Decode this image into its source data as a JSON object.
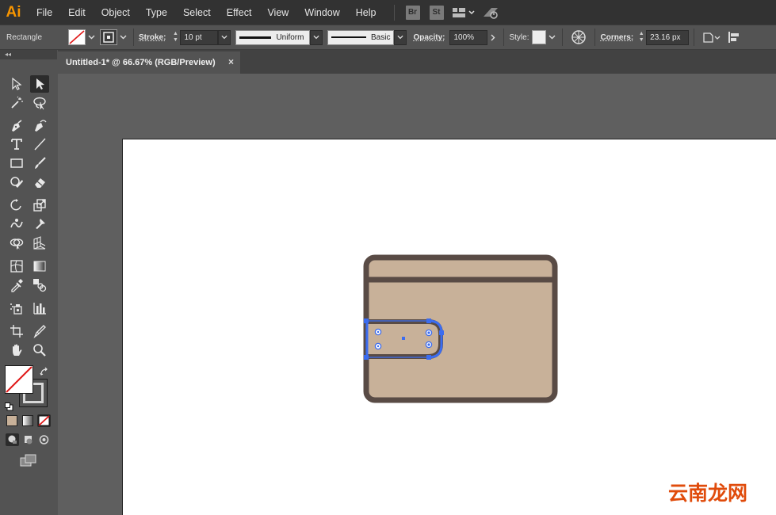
{
  "app": {
    "logo": "Ai",
    "menu": [
      "File",
      "Edit",
      "Object",
      "Type",
      "Select",
      "Effect",
      "View",
      "Window",
      "Help"
    ],
    "bridge_badge": "Br",
    "stock_badge": "St"
  },
  "control_bar": {
    "selection_type": "Rectangle",
    "stroke_label": "Stroke:",
    "stroke_weight": "10 pt",
    "profile_label": "Uniform",
    "brush_label": "Basic",
    "opacity_label": "Opacity:",
    "opacity_value": "100%",
    "style_label": "Style:",
    "corners_label": "Corners:",
    "corners_value": "23.16 px"
  },
  "document": {
    "tab_title": "Untitled-1* @ 66.67% (RGB/Preview)",
    "close_glyph": "×"
  },
  "watermark": "云南龙网",
  "colors": {
    "wallet_fill": "#c8b199",
    "wallet_stroke": "#594b45",
    "selection": "#3b6cf0",
    "logo": "#f79500",
    "watermark": "#e04b0b"
  }
}
